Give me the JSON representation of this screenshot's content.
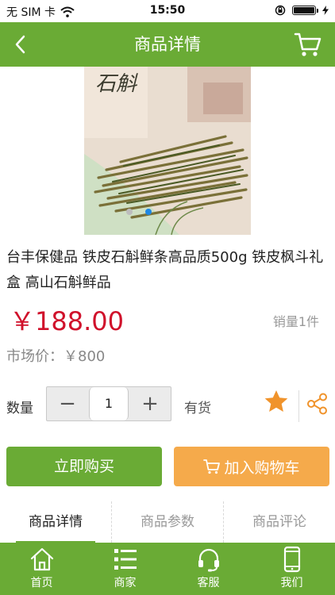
{
  "status_bar": {
    "carrier": "无 SIM 卡",
    "time": "15:50"
  },
  "header": {
    "title": "商品详情",
    "back_icon": "chevron-left-icon",
    "cart_icon": "cart-icon"
  },
  "gallery": {
    "slide_count": 2,
    "active_slide": 2
  },
  "product": {
    "title": "台丰保健品 铁皮石斛鲜条高品质500g 铁皮枫斗礼盒 高山石斛鲜品",
    "price": "￥188.00",
    "sales": "销量1件",
    "market_price": "市场价：￥800"
  },
  "quantity": {
    "label": "数量",
    "minus": "−",
    "value": "1",
    "plus": "+",
    "stock": "有货"
  },
  "actions": {
    "buy_now": "立即购买",
    "add_to_cart": "加入购物车"
  },
  "tabs": [
    {
      "label": "商品详情",
      "active": true
    },
    {
      "label": "商品参数",
      "active": false
    },
    {
      "label": "商品评论",
      "active": false
    }
  ],
  "bottom_nav": [
    {
      "label": "首页",
      "icon": "home-icon"
    },
    {
      "label": "商家",
      "icon": "list-icon"
    },
    {
      "label": "客服",
      "icon": "headset-icon"
    },
    {
      "label": "我们",
      "icon": "phone-icon"
    }
  ],
  "colors": {
    "primary_green": "#6aab35",
    "price_red": "#d0112b",
    "cart_orange": "#f5aa4b",
    "star_orange": "#f0932b"
  }
}
